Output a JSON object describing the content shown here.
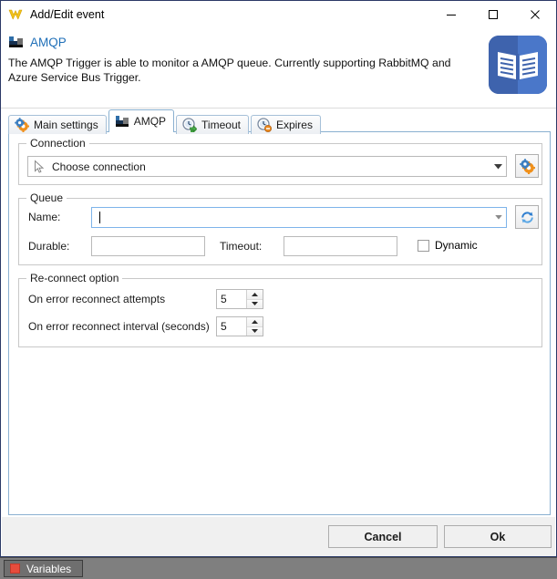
{
  "window": {
    "title": "Add/Edit event",
    "icon": "app-logo-v-icon",
    "controls": {
      "minimize": "minimize-icon",
      "maximize": "maximize-icon",
      "close": "close-icon"
    }
  },
  "header": {
    "icon": "amqp-bar-chart-icon",
    "title": "AMQP",
    "description": "The AMQP Trigger is able to monitor a AMQP queue. Currently supporting RabbitMQ and Azure Service Bus Trigger.",
    "badge_icon": "open-book-icon",
    "badge_color": "#3e63ad",
    "title_color": "#1f6fb8"
  },
  "tabs": [
    {
      "label": "Main settings",
      "icon": "gear-icon",
      "selected": false
    },
    {
      "label": "AMQP",
      "icon": "amqp-bar-chart-icon",
      "selected": true
    },
    {
      "label": "Timeout",
      "icon": "clock-green-arrow-icon",
      "selected": false
    },
    {
      "label": "Expires",
      "icon": "clock-orange-badge-icon",
      "selected": false
    }
  ],
  "connection_group": {
    "label": "Connection",
    "combo": {
      "icon": "cursor-pointer-icon",
      "value": "Choose connection",
      "arrow": "chevron-down-icon"
    },
    "settings_button": {
      "icon": "gear-icon"
    }
  },
  "queue_group": {
    "label": "Queue",
    "name_label": "Name:",
    "name_value": "",
    "name_focused": true,
    "refresh_button": {
      "icon": "refresh-icon"
    },
    "durable_label": "Durable:",
    "durable_value": "",
    "timeout_label": "Timeout:",
    "timeout_value": "",
    "dynamic_label": "Dynamic",
    "dynamic_checked": false
  },
  "reconnect_group": {
    "label": "Re-connect option",
    "attempts_label": "On error reconnect attempts",
    "attempts_value": "5",
    "interval_label": "On error reconnect interval (seconds)",
    "interval_value": "5"
  },
  "footer": {
    "cancel_label": "Cancel",
    "ok_label": "Ok"
  },
  "statusbar": {
    "variables_label": "Variables",
    "variables_icon": "red-square-icon"
  }
}
